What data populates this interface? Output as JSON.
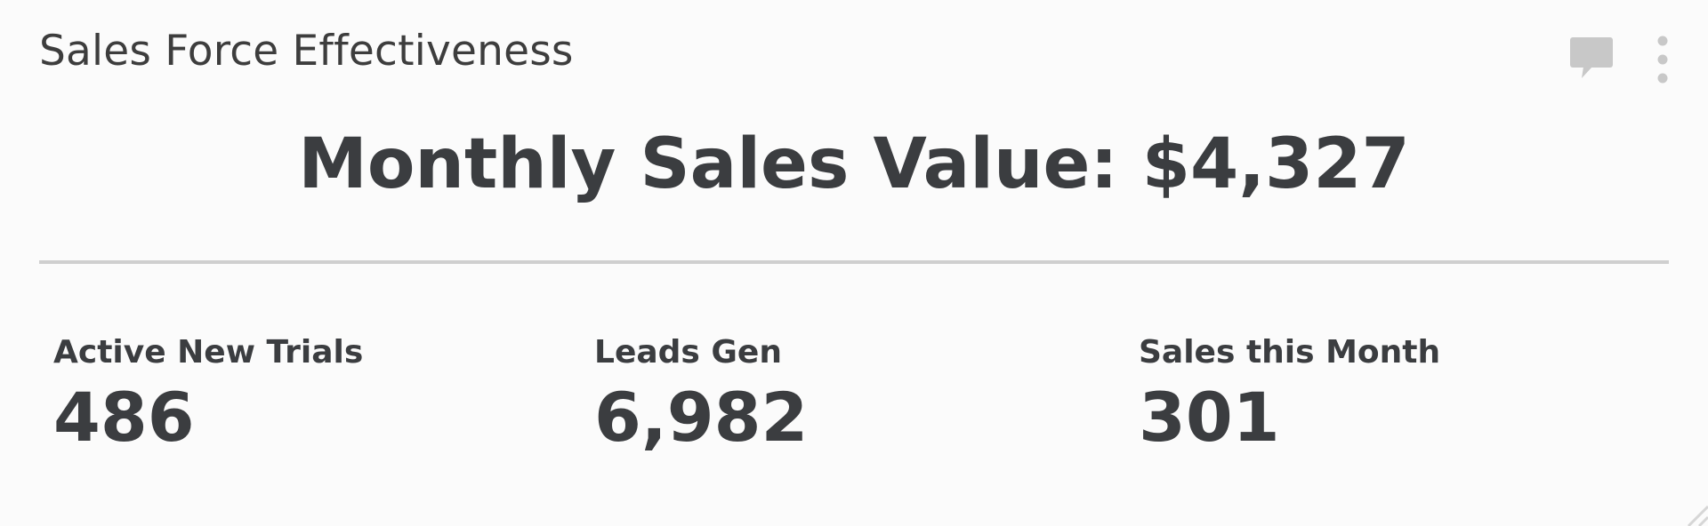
{
  "widget": {
    "title": "Sales Force Effectiveness",
    "headline": "Monthly Sales Value: $4,327",
    "metrics": [
      {
        "label": "Active New Trials",
        "value": "486"
      },
      {
        "label": "Leads Gen",
        "value": "6,982"
      },
      {
        "label": "Sales this Month",
        "value": "301"
      }
    ],
    "icons": {
      "comment": "comment-icon",
      "menu": "more-vertical-icon",
      "resize": "resize-handle-icon"
    },
    "colors": {
      "background": "#fbfbfb",
      "text": "#3b3d40",
      "icon": "#c8c8c8",
      "divider": "#cfcfcf"
    }
  }
}
